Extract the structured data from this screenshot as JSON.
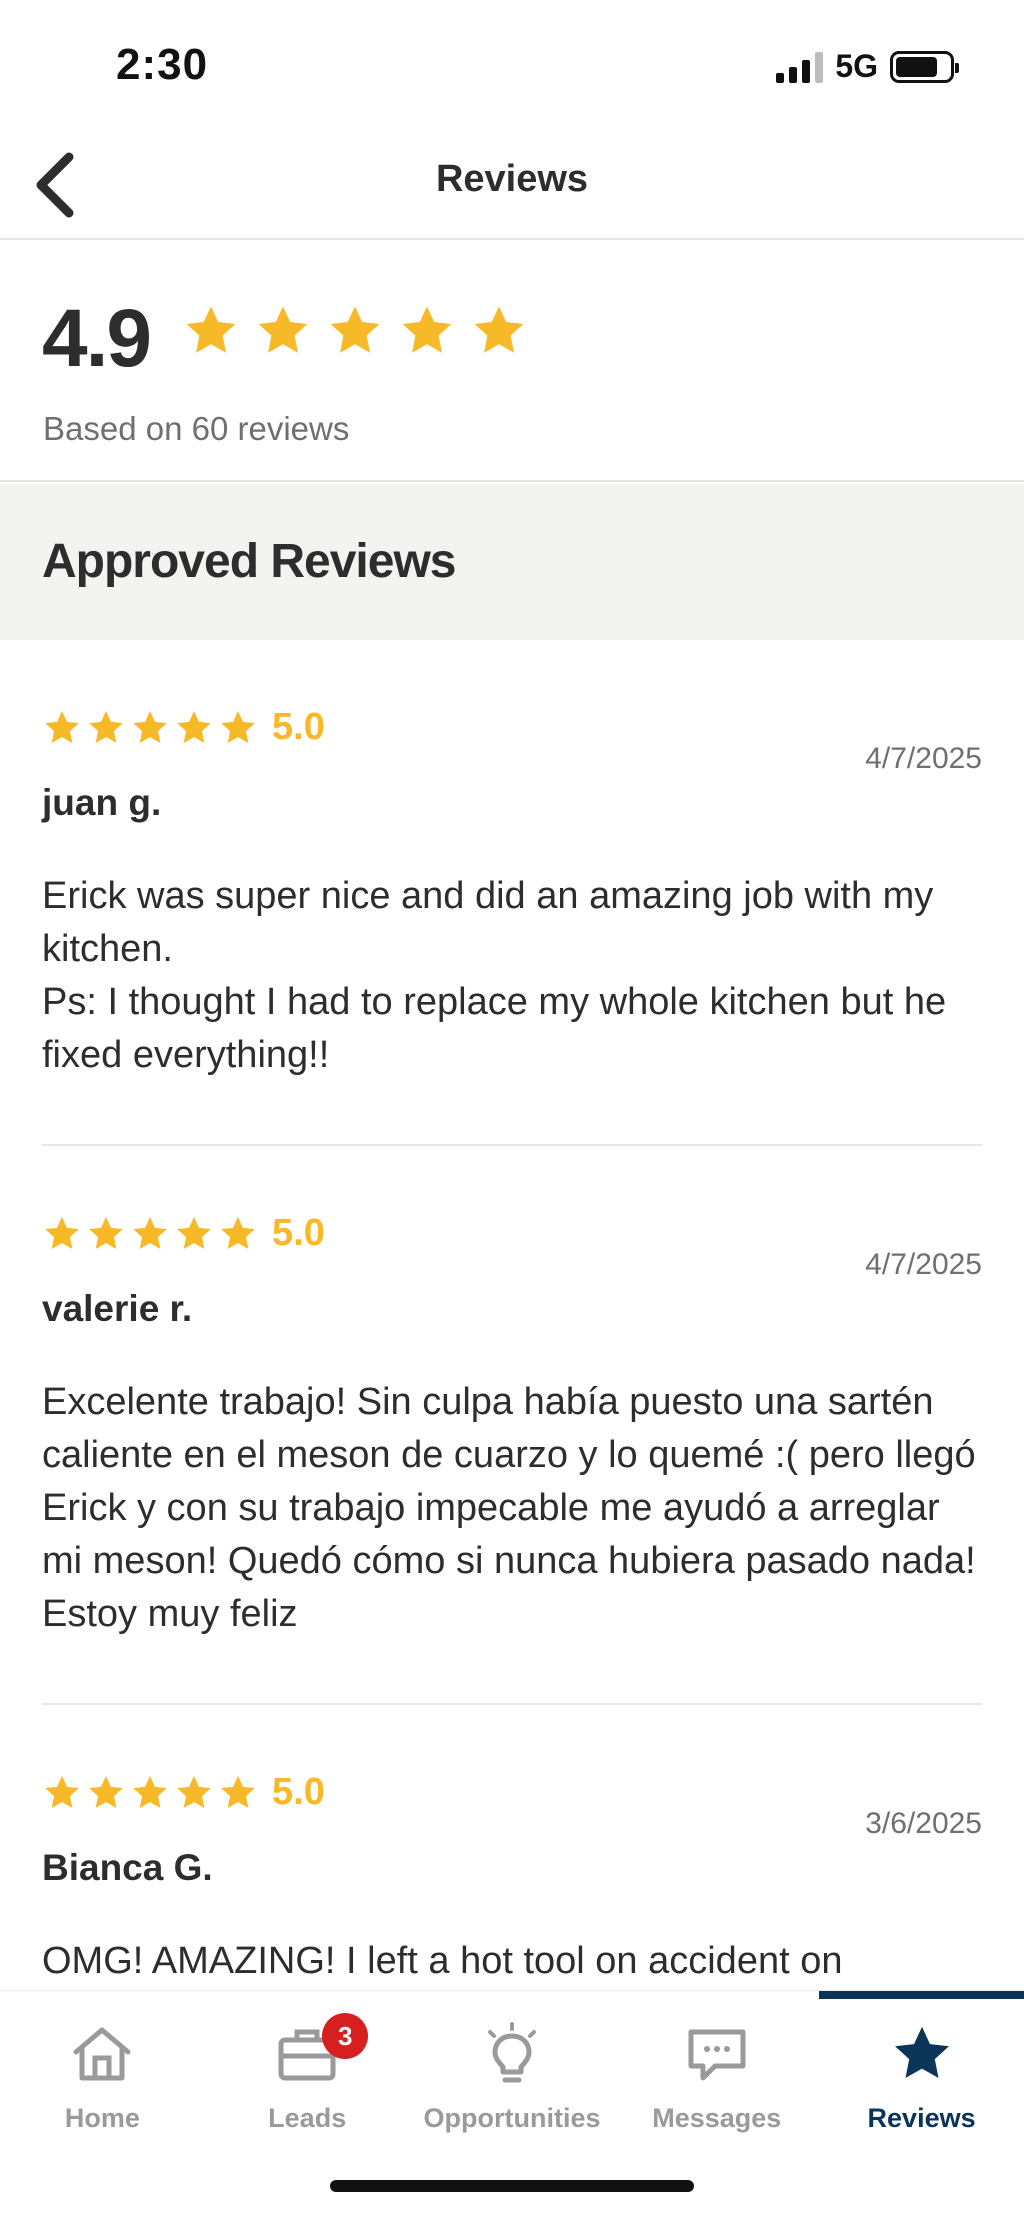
{
  "status_bar": {
    "time": "2:30",
    "network": "5G",
    "battery_level": 0.78
  },
  "header": {
    "title": "Reviews"
  },
  "summary": {
    "score": "4.9",
    "stars": 5,
    "based_on": "Based on 60 reviews"
  },
  "section": {
    "title": "Approved Reviews"
  },
  "colors": {
    "star": "#f7b928",
    "accent": "#0b3558",
    "badge": "#d6201f"
  },
  "reviews": [
    {
      "rating": "5.0",
      "date": "4/7/2025",
      "name": "juan g.",
      "text": "Erick was super nice and did an amazing job with my kitchen.\nPs: I thought I had to replace my whole kitchen but he fixed everything!!"
    },
    {
      "rating": "5.0",
      "date": "4/7/2025",
      "name": "valerie r.",
      "text": "Excelente trabajo! Sin culpa había puesto una sartén caliente en el meson de cuarzo y lo quemé :( pero llegó Erick y con su trabajo impecable me ayudó a arreglar mi meson! Quedó cómo si nunca hubiera pasado nada! Estoy muy feliz"
    },
    {
      "rating": "5.0",
      "date": "3/6/2025",
      "name": "Bianca G.",
      "text": "OMG! AMAZING! I left a hot tool on accident on"
    }
  ],
  "tabbar": {
    "tabs": [
      {
        "label": "Home",
        "icon": "home-icon"
      },
      {
        "label": "Leads",
        "icon": "briefcase-icon",
        "badge": "3"
      },
      {
        "label": "Opportunities",
        "icon": "lightbulb-icon"
      },
      {
        "label": "Messages",
        "icon": "chat-icon"
      },
      {
        "label": "Reviews",
        "icon": "star-icon",
        "active": true
      }
    ]
  }
}
